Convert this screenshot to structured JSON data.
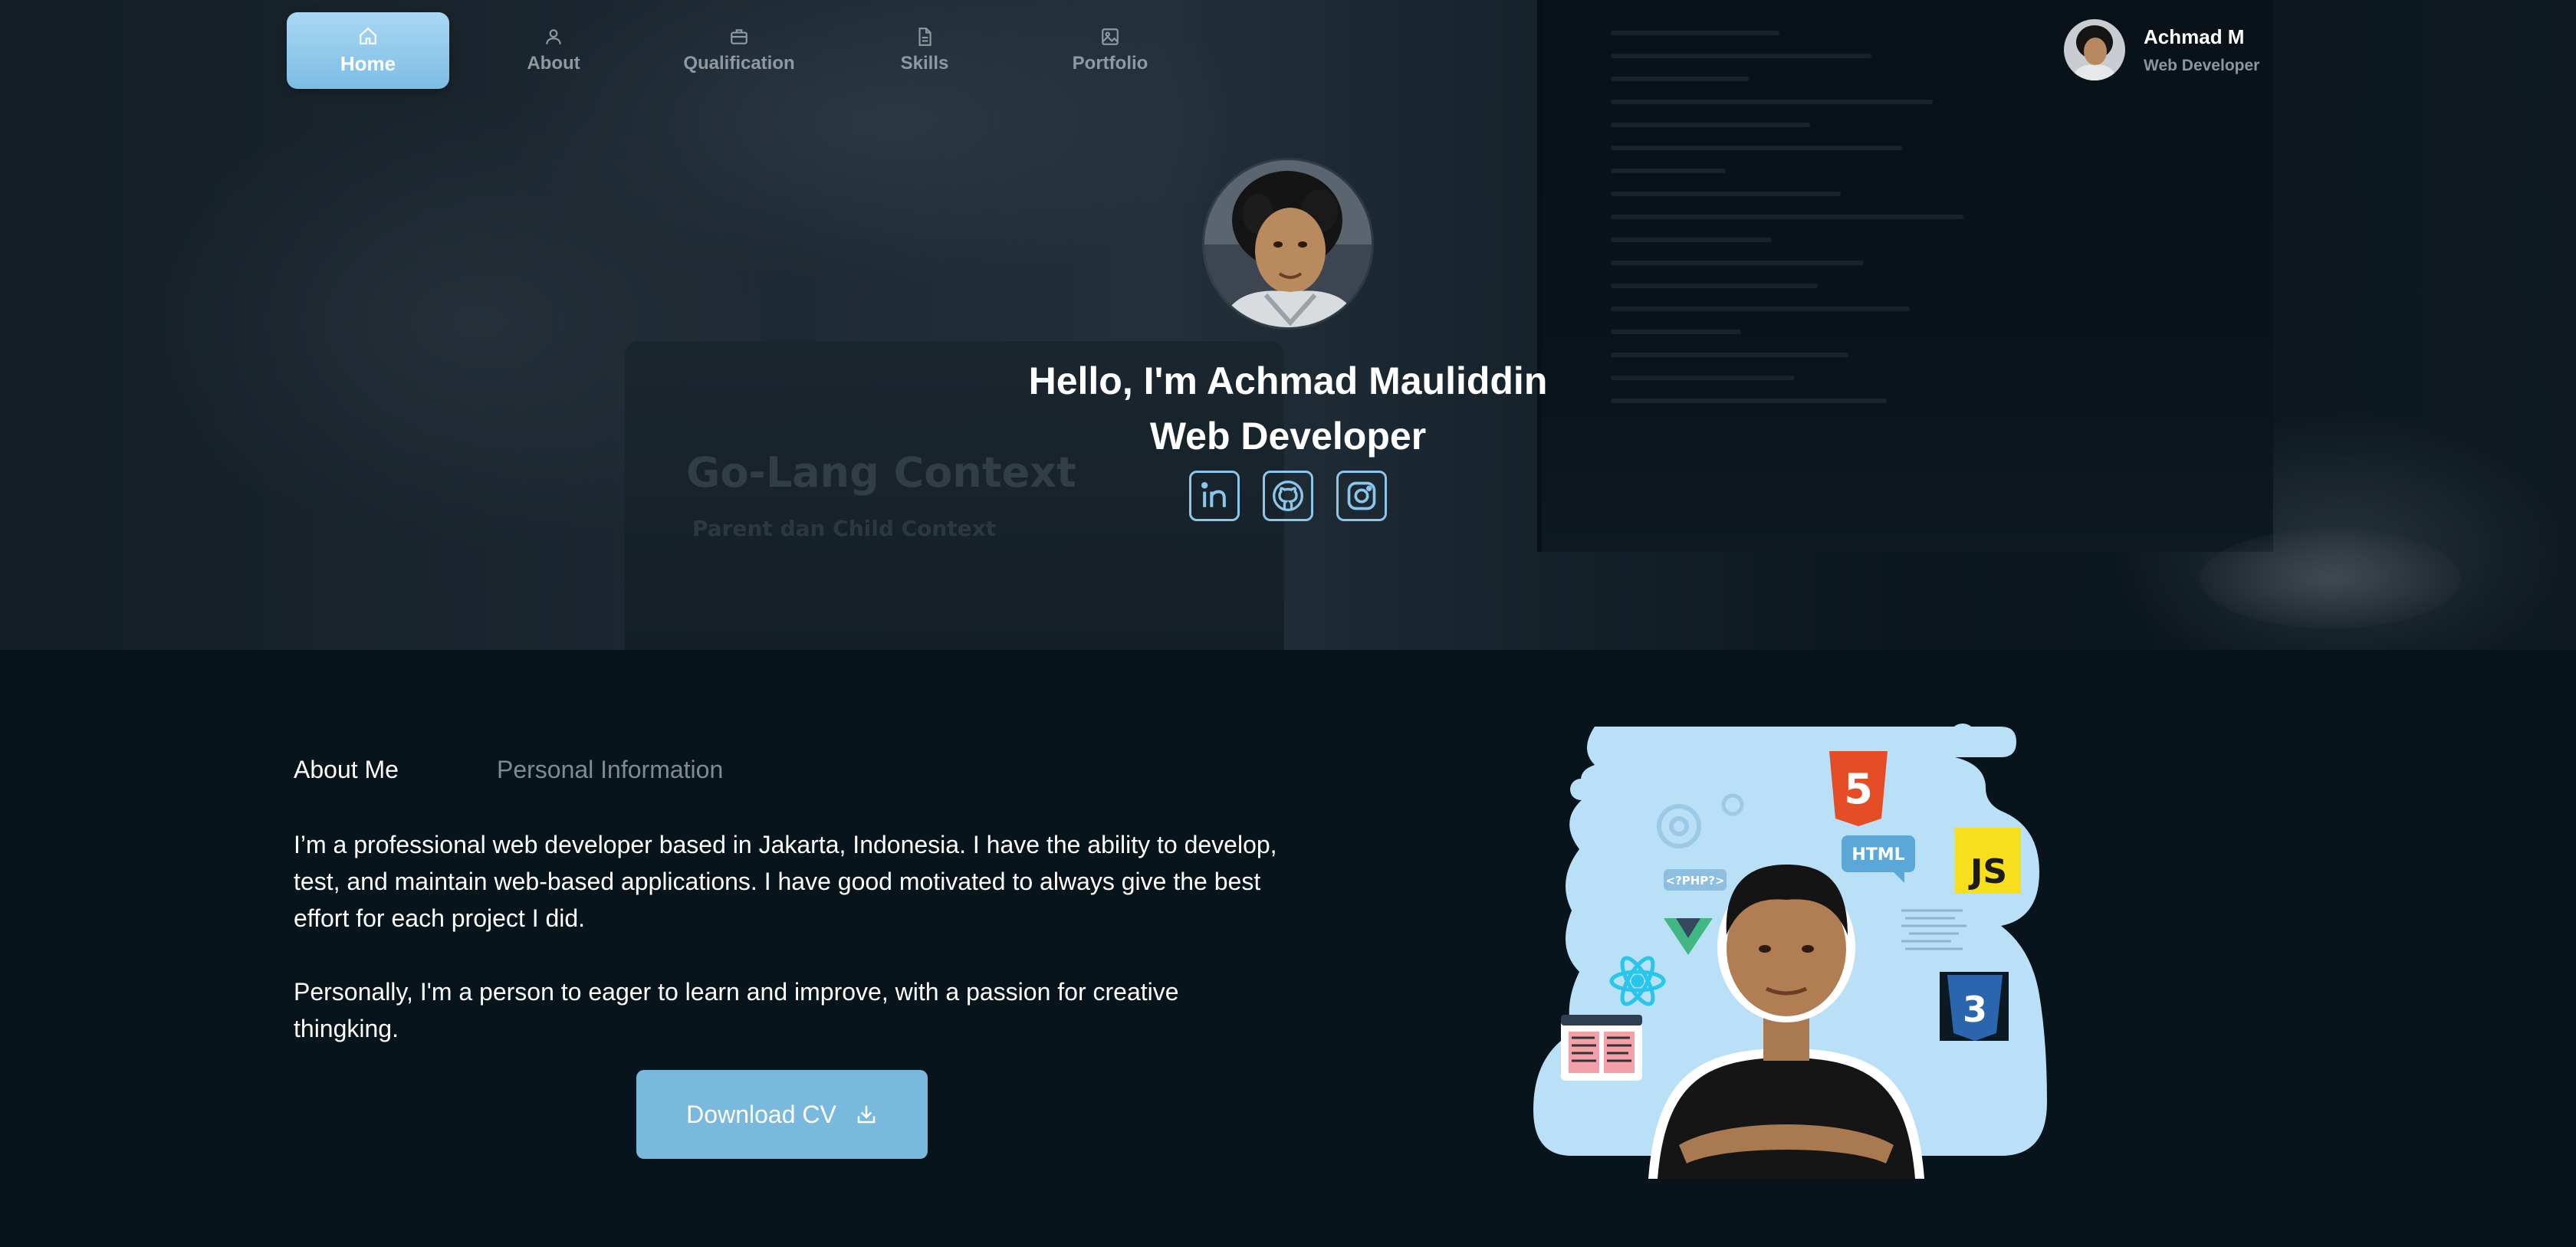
{
  "nav": {
    "items": [
      {
        "label": "Home",
        "icon": "home-icon",
        "active": true
      },
      {
        "label": "About",
        "icon": "user-icon",
        "active": false
      },
      {
        "label": "Qualification",
        "icon": "briefcase-icon",
        "active": false
      },
      {
        "label": "Skills",
        "icon": "document-icon",
        "active": false
      },
      {
        "label": "Portfolio",
        "icon": "image-icon",
        "active": false
      }
    ],
    "profile": {
      "name": "Achmad M",
      "role": "Web Developer"
    }
  },
  "hero": {
    "greeting": "Hello, I'm Achmad Mauliddin",
    "role": "Web Developer",
    "background_text": {
      "title": "Go-Lang Context",
      "subtitle": "Parent dan Child Context"
    },
    "socials": [
      {
        "name": "linkedin-icon"
      },
      {
        "name": "github-icon"
      },
      {
        "name": "instagram-icon"
      }
    ]
  },
  "about": {
    "tabs": [
      {
        "label": "About Me",
        "active": true
      },
      {
        "label": "Personal Information",
        "active": false
      }
    ],
    "paragraphs": [
      "I’m a professional web developer based in Jakarta, Indonesia. I have the ability to develop, test, and maintain web-based applications. I have good motivated to always give the best effort for each project I did.",
      "Personally, I'm a person to eager to learn and improve, with a passion for creative thingking."
    ],
    "download_label": "Download CV",
    "illustration_labels": {
      "php": "<?PHP?>",
      "html": "HTML",
      "js": "JS",
      "html5": "5",
      "css3": "3"
    }
  },
  "colors": {
    "accent": "#79b9de",
    "background": "#08141b",
    "illustration_blob": "#b9e0f7",
    "muted": "#7f8b93"
  }
}
